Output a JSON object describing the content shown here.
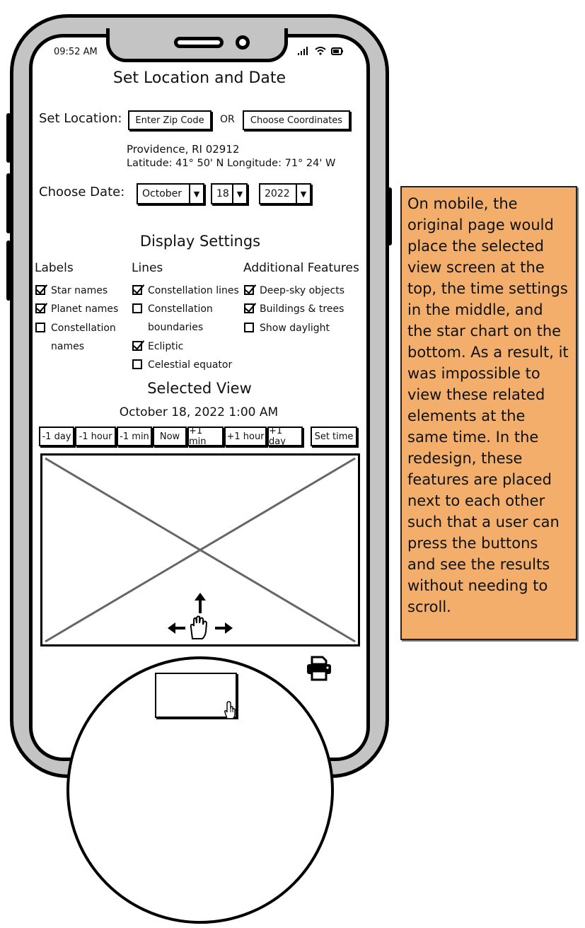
{
  "status": {
    "time": "09:52 AM"
  },
  "title": "Set Location and Date",
  "location": {
    "label": "Set Location:",
    "zip_button": "Enter Zip Code",
    "or_text": "OR",
    "coord_button": "Choose Coordinates",
    "place": "Providence, RI 02912",
    "coords": "Latitude: 41° 50' N Longitude: 71° 24' W"
  },
  "date": {
    "label": "Choose Date:",
    "month": "October",
    "day": "18",
    "year": "2022"
  },
  "display": {
    "heading": "Display Settings",
    "labels": {
      "heading": "Labels",
      "items": [
        {
          "text": "Star names",
          "checked": true
        },
        {
          "text": "Planet names",
          "checked": true
        },
        {
          "text": "Constellation names",
          "checked": false
        }
      ]
    },
    "lines": {
      "heading": "Lines",
      "items": [
        {
          "text": "Constellation lines",
          "checked": true
        },
        {
          "text": "Constellation boundaries",
          "checked": false
        },
        {
          "text": "Ecliptic",
          "checked": true
        },
        {
          "text": "Celestial equator",
          "checked": false
        }
      ]
    },
    "features": {
      "heading": "Additional Features",
      "items": [
        {
          "text": "Deep-sky objects",
          "checked": true
        },
        {
          "text": "Buildings & trees",
          "checked": true
        },
        {
          "text": "Show daylight",
          "checked": false
        }
      ]
    }
  },
  "selected_view": {
    "heading": "Selected View",
    "datetime": "October 18, 2022 1:00 AM",
    "buttons": [
      "-1 day",
      "-1 hour",
      "-1 min",
      "Now",
      "+1 min",
      "+1 hour",
      "+1 day"
    ],
    "set_time": "Set time"
  },
  "note": "On mobile, the original page would place the selected view screen at the top, the time settings in the middle, and the star chart on the bottom. As a result, it was impossible to view these related elements at the same time. In the redesign, these features are placed next to each other such that a user can press the buttons and see the results without needing to scroll.",
  "icons": {
    "pan": "hand-pan-icon",
    "print": "printer-icon",
    "cursor": "hand-cursor-icon"
  },
  "colors": {
    "frame": "#c4c4c4",
    "note_bg": "#f4ae6b"
  }
}
